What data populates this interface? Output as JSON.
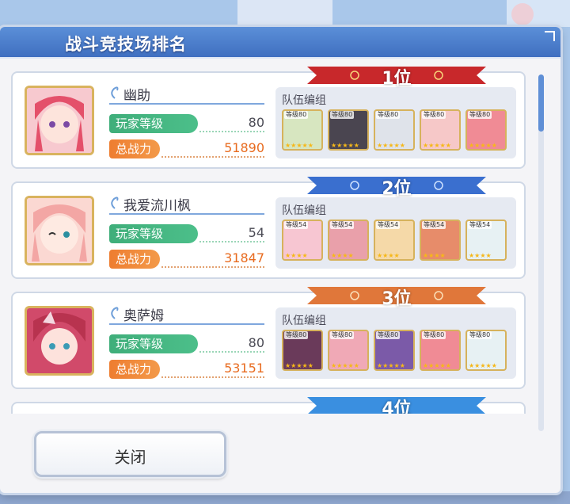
{
  "dialog": {
    "title": "战斗竞技场排名",
    "team_label": "队伍编组",
    "level_label": "玩家等级",
    "power_label": "总战力",
    "close_label": "关闭"
  },
  "rankings": [
    {
      "rank_text": "1位",
      "name": "幽助",
      "level": "80",
      "power": "51890",
      "team_level": "等级80",
      "team_stars": "★★★★★",
      "banner_color": "#c8282b"
    },
    {
      "rank_text": "2位",
      "name": "我爱流川枫",
      "level": "54",
      "power": "31847",
      "team_level": "等级54",
      "team_stars": "★★★★",
      "banner_color": "#3a6fcf"
    },
    {
      "rank_text": "3位",
      "name": "奥萨姆",
      "level": "80",
      "power": "53151",
      "team_level": "等级80",
      "team_stars": "★★★★★",
      "banner_color": "#e0773a"
    },
    {
      "rank_text": "4位",
      "banner_color": "#3a8fe0"
    }
  ],
  "colors": {
    "title_bar": "#4a7fcf",
    "level_pill": "#3fae7a",
    "power_pill": "#ee7d30"
  }
}
